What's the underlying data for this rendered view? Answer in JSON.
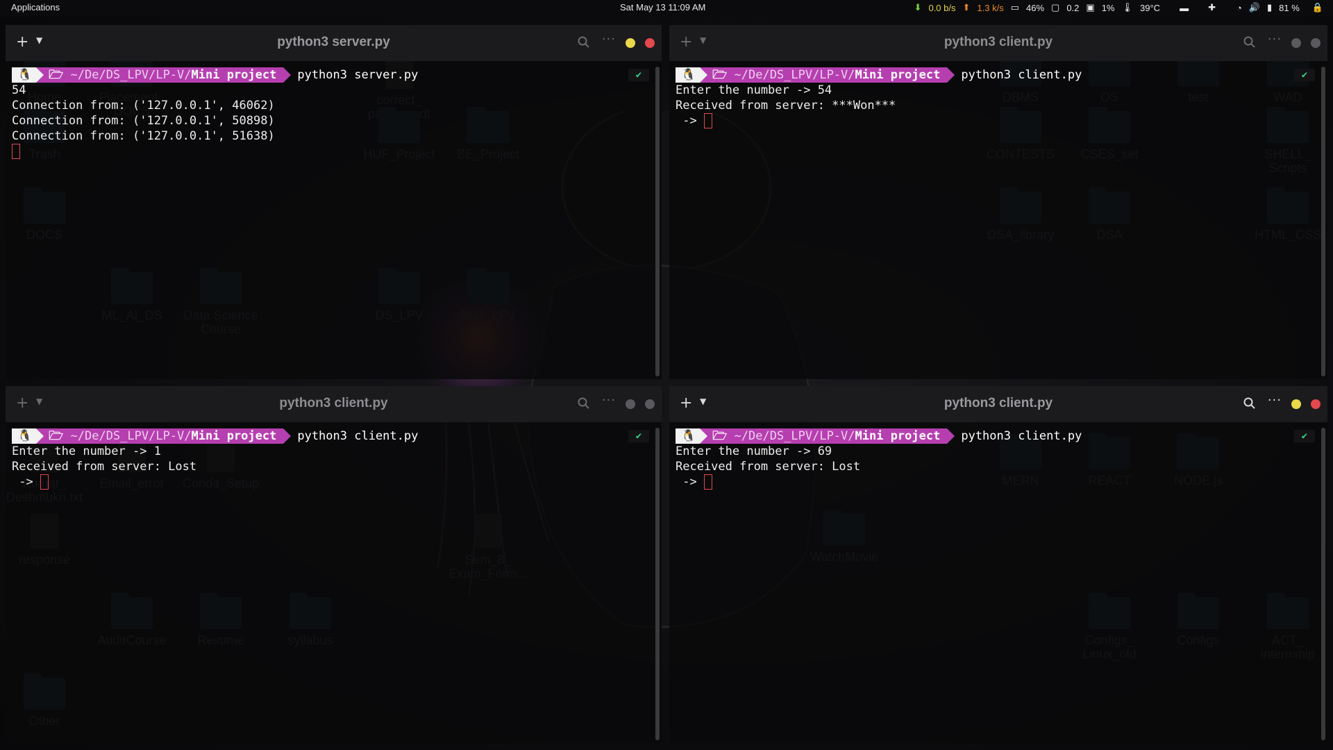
{
  "topbar": {
    "applications": "Applications",
    "datetime": "Sat May 13  11:09 AM",
    "net_down": "0.0 b/s",
    "net_up": "1.3 k/s",
    "cpu": "46%",
    "load": "0.2",
    "mem": "1%",
    "temp": "39°C",
    "battery": "81 %"
  },
  "desktop_icons": [
    {
      "label": "Home"
    },
    {
      "label": "Placement_ DOCS"
    },
    {
      "label": "correct_ params.odt"
    },
    {
      "label": "DBMS"
    },
    {
      "label": "OS"
    },
    {
      "label": "test"
    },
    {
      "label": "WAD"
    },
    {
      "label": "Trash"
    },
    {
      "label": "HUF_Project"
    },
    {
      "label": "BE_Project"
    },
    {
      "label": "CONTESTS"
    },
    {
      "label": "CSES_set"
    },
    {
      "label": "SHELL_ Scripts"
    },
    {
      "label": "DOCS"
    },
    {
      "label": "DSA_library"
    },
    {
      "label": "DSA"
    },
    {
      "label": "HTML_CSS"
    },
    {
      "label": "ML_AI_DS"
    },
    {
      "label": "Data Science Course"
    },
    {
      "label": "DS_LPV"
    },
    {
      "label": "BCT_LPV"
    },
    {
      "label": "Kumar_ Deshmukh.txt"
    },
    {
      "label": "Email_error"
    },
    {
      "label": "Conda_Setup"
    },
    {
      "label": "MERN"
    },
    {
      "label": "REACT"
    },
    {
      "label": "NODE.js"
    },
    {
      "label": "response"
    },
    {
      "label": "Sem_8_ Exam_Form..."
    },
    {
      "label": "WatchMovie"
    },
    {
      "label": "AuditCourse"
    },
    {
      "label": "Resume"
    },
    {
      "label": "syllabus"
    },
    {
      "label": "Configs_ Linux_old"
    },
    {
      "label": "Configs"
    },
    {
      "label": "ACT_ internship"
    },
    {
      "label": "Other"
    }
  ],
  "prompt": {
    "os_glyph": "🐧",
    "folder_glyph": "🗁",
    "path_dim": "~/De/DS_LPV/LP-V/",
    "path_bold": "Mini project",
    "check": "✔"
  },
  "panes": [
    {
      "title": "python3 server.py",
      "command": "python3 server.py",
      "lines": [
        "54",
        "Connection from: ('127.0.0.1', 46062)",
        "Connection from: ('127.0.0.1', 50898)",
        "Connection from: ('127.0.0.1', 51638)"
      ],
      "tail": ""
    },
    {
      "title": "python3 client.py",
      "command": "python3 client.py",
      "lines": [
        "Enter the number -> 54",
        "Received from server: ***Won***"
      ],
      "tail": " -> "
    },
    {
      "title": "python3 client.py",
      "command": "python3 client.py",
      "lines": [
        "Enter the number -> 1",
        "Received from server: Lost"
      ],
      "tail": " -> "
    },
    {
      "title": "python3 client.py",
      "command": "python3 client.py",
      "lines": [
        "Enter the number -> 69",
        "Received from server: Lost"
      ],
      "tail": " -> "
    }
  ]
}
